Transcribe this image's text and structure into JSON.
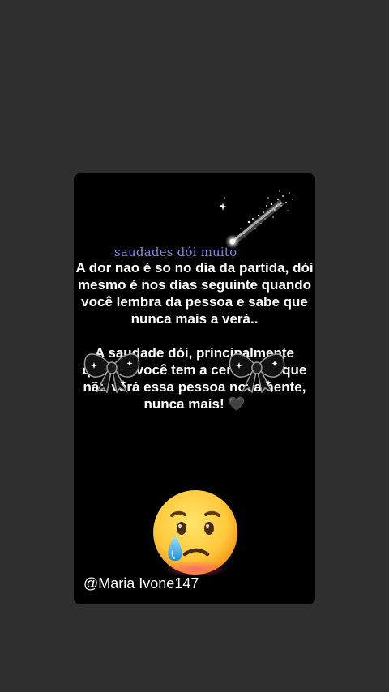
{
  "story": {
    "headline": "saudades dói muito",
    "message_paragraph_1": "A dor nao é so no dia da partida, dói mesmo é nos dias seguinte quando você lembra da pessoa e sabe que nunca mais a verá..",
    "message_paragraph_2": "A saudade dói, principalmente quando você tem a certeza de que não verá essa pessoa novamente, nunca mais! 🖤",
    "handle": "@Maria Ivone147"
  },
  "decorations": {
    "sparkle": "shooting-star-icon",
    "bows": "black-bow-icon",
    "emoji": "crying-face-emoji"
  },
  "colors": {
    "background": "#2f2f30",
    "card": "#000000",
    "headline": "#8a84e6",
    "text": "#ffffff"
  }
}
